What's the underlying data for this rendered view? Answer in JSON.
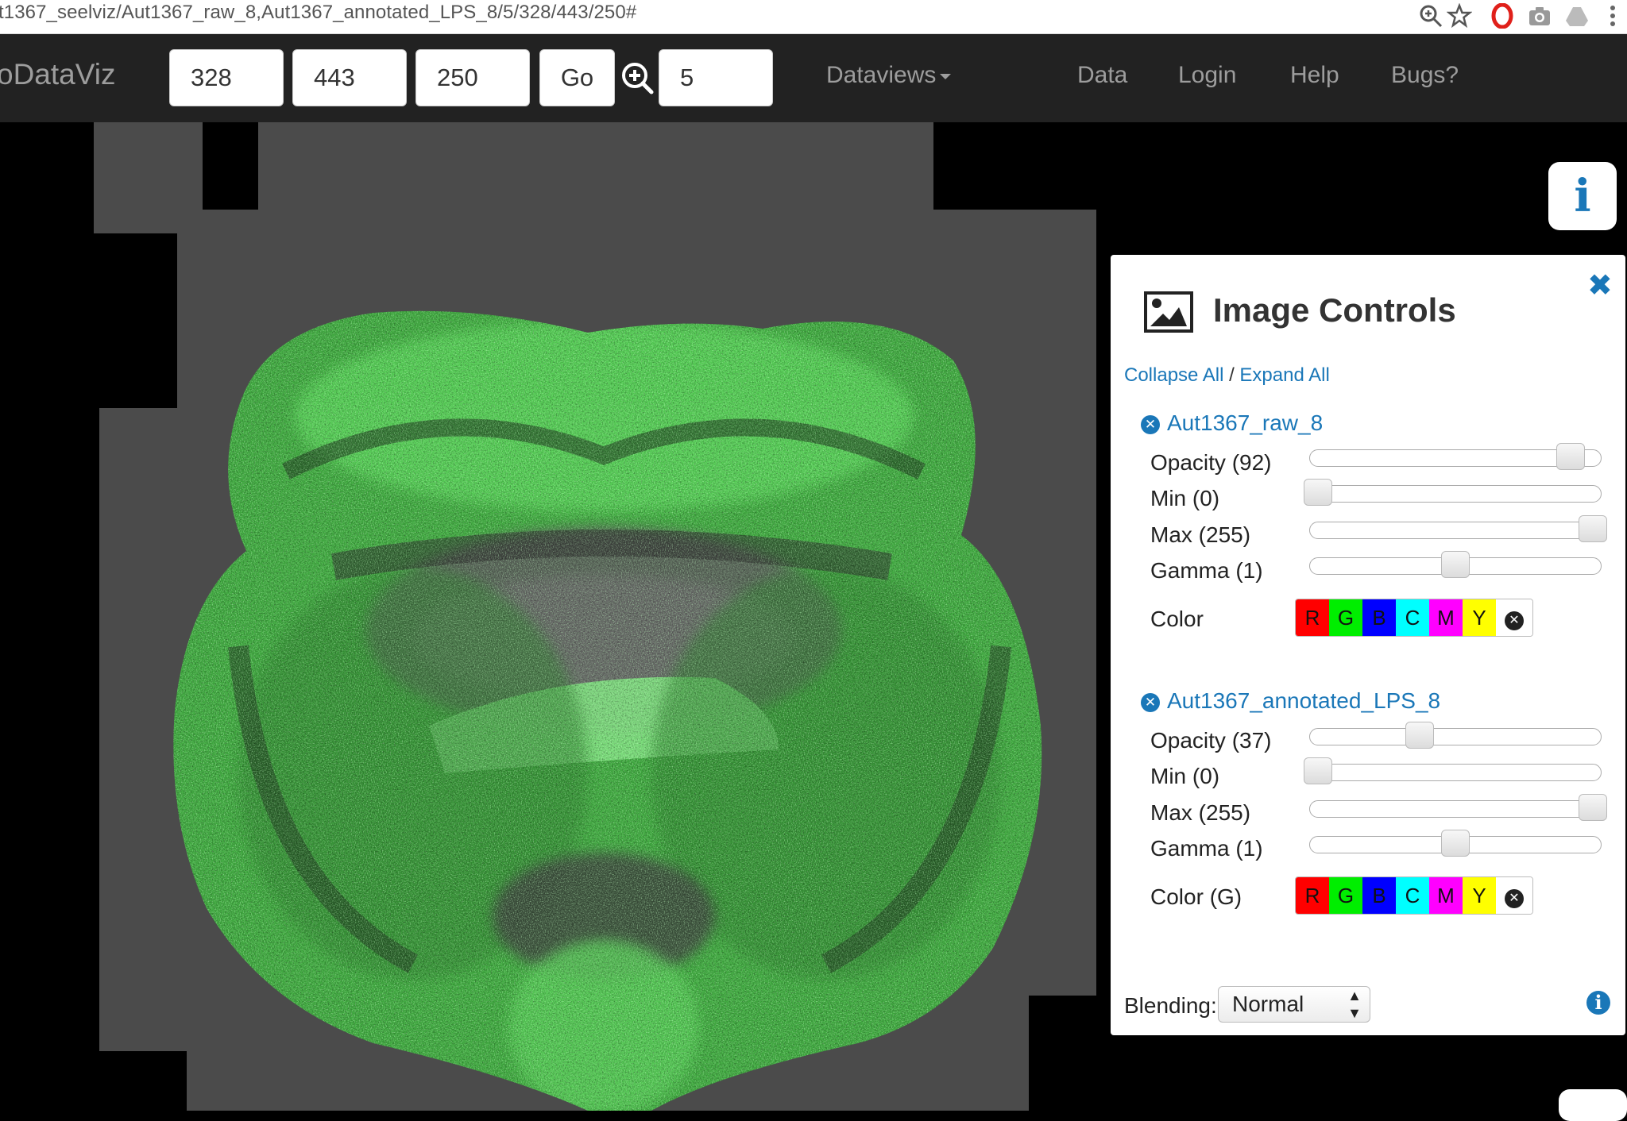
{
  "browser": {
    "url": "t1367_seelviz/Aut1367_raw_8,Aut1367_annotated_LPS_8/5/328/443/250#"
  },
  "navbar": {
    "brand": "oDataViz",
    "coord_x": "328",
    "coord_y": "443",
    "coord_z": "250",
    "go_label": "Go",
    "zoom_value": "5",
    "menu": [
      "Dataviews",
      "Data",
      "Login",
      "Help",
      "Bugs?"
    ]
  },
  "info_button_label": "i",
  "panel": {
    "title": "Image Controls",
    "collapse_all": "Collapse All",
    "separator": "/",
    "expand_all": "Expand All",
    "layers": [
      {
        "name": "Aut1367_raw_8",
        "opacity_label": "Opacity (92)",
        "opacity": 92,
        "min_label": "Min (0)",
        "min": 0,
        "max_label": "Max (255)",
        "max": 255,
        "gamma_label": "Gamma (1)",
        "gamma": 1,
        "color_label": "Color"
      },
      {
        "name": "Aut1367_annotated_LPS_8",
        "opacity_label": "Opacity (37)",
        "opacity": 37,
        "min_label": "Min (0)",
        "min": 0,
        "max_label": "Max (255)",
        "max": 255,
        "gamma_label": "Gamma (1)",
        "gamma": 1,
        "color_label": "Color (G)"
      }
    ],
    "swatches": [
      {
        "label": "R",
        "color": "#ff0000"
      },
      {
        "label": "G",
        "color": "#00ee00"
      },
      {
        "label": "B",
        "color": "#0000ff"
      },
      {
        "label": "C",
        "color": "#00ffff"
      },
      {
        "label": "M",
        "color": "#ff00ff"
      },
      {
        "label": "Y",
        "color": "#ffff00"
      }
    ],
    "blending_label": "Blending:",
    "blending_value": "Normal"
  },
  "colors": {
    "navbar_bg": "#222222",
    "nav_text": "#9d9d9d",
    "link": "#1a77b8",
    "overlay_green": "#4ee04e",
    "tissue_gray": "#4a4a4a"
  }
}
